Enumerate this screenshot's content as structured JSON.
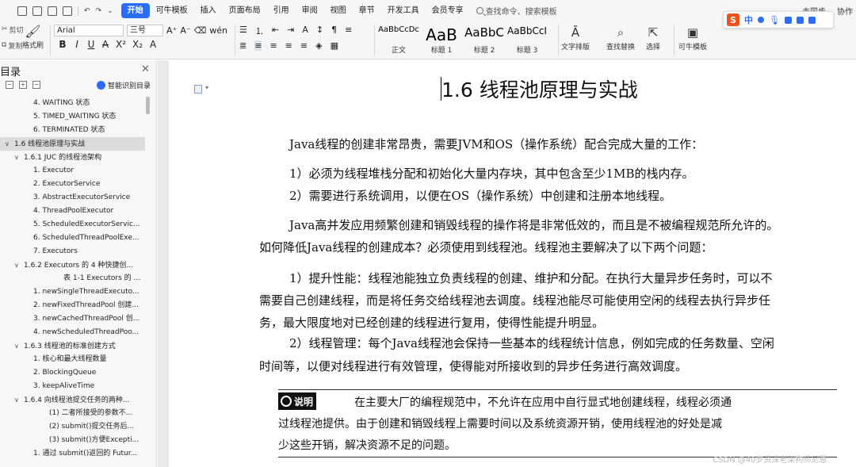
{
  "menubar": {
    "tabs": [
      "开始",
      "可牛模板",
      "插入",
      "页面布局",
      "引用",
      "审阅",
      "视图",
      "章节",
      "开发工具",
      "会员专享"
    ],
    "active_tab": "开始",
    "search_placeholder": "查找命令、搜索模板",
    "right_items": [
      "未同步",
      "协作"
    ]
  },
  "ribbon": {
    "clipboard": {
      "cut": "剪切",
      "copy": "复制",
      "format_painter": "格式刷"
    },
    "font": {
      "name": "Arial",
      "size": "三号"
    },
    "format_buttons": [
      "B",
      "I",
      "U",
      "A",
      "X²",
      "X₂",
      "A"
    ],
    "styles": [
      {
        "preview": "AaBbCcDc",
        "label": "正文",
        "size": 10
      },
      {
        "preview": "AaB",
        "label": "标题 1",
        "size": 20
      },
      {
        "preview": "AaBbC",
        "label": "标题 2",
        "size": 15
      },
      {
        "preview": "AaBbCcI",
        "label": "标题 3",
        "size": 12
      }
    ],
    "text_layout": "文字排版",
    "find_replace": "查找替换",
    "select": "选择",
    "template": "可牛模板"
  },
  "ime": {
    "logo": "S",
    "lang": "中"
  },
  "sidebar": {
    "title": "目录",
    "smart_toc": "智能识别目录",
    "items": [
      {
        "text": "4. WAITING 状态",
        "indent": 42,
        "caret": "",
        "selected": false
      },
      {
        "text": "5. TIMED_WAITING 状态",
        "indent": 42,
        "caret": "",
        "selected": false
      },
      {
        "text": "6. TERMINATED 状态",
        "indent": 42,
        "caret": "",
        "selected": false
      },
      {
        "text": "1.6 线程池原理与实战",
        "indent": 6,
        "caret": "∨",
        "selected": true
      },
      {
        "text": "1.6.1 JUC 的线程池架构",
        "indent": 18,
        "caret": "∨",
        "selected": false
      },
      {
        "text": "1. Executor",
        "indent": 42,
        "caret": "",
        "selected": false
      },
      {
        "text": "2. ExecutorService",
        "indent": 42,
        "caret": "",
        "selected": false
      },
      {
        "text": "3. AbstractExecutorService",
        "indent": 42,
        "caret": "",
        "selected": false
      },
      {
        "text": "4. ThreadPoolExecutor",
        "indent": 42,
        "caret": "",
        "selected": false
      },
      {
        "text": "5. ScheduledExecutorServic...",
        "indent": 42,
        "caret": "",
        "selected": false
      },
      {
        "text": "6. ScheduledThreadPoolExe...",
        "indent": 42,
        "caret": "",
        "selected": false
      },
      {
        "text": "7. Executors",
        "indent": 42,
        "caret": "",
        "selected": false
      },
      {
        "text": "1.6.2 Executors 的 4 种快捷创...",
        "indent": 18,
        "caret": "∨",
        "selected": false
      },
      {
        "text": "表 1-1 Executors 的 4 ...",
        "indent": 80,
        "caret": "",
        "selected": false
      },
      {
        "text": "1. newSingleThreadExecuto...",
        "indent": 42,
        "caret": "",
        "selected": false
      },
      {
        "text": "2. newFixedThreadPool 创建...",
        "indent": 42,
        "caret": "",
        "selected": false
      },
      {
        "text": "3. newCachedThreadPool 创...",
        "indent": 42,
        "caret": "",
        "selected": false
      },
      {
        "text": "4. newScheduledThreadPoo...",
        "indent": 42,
        "caret": "",
        "selected": false
      },
      {
        "text": "1.6.3 线程池的标准创建方式",
        "indent": 18,
        "caret": "∨",
        "selected": false
      },
      {
        "text": "1. 核心和最大线程数量",
        "indent": 42,
        "caret": "",
        "selected": false
      },
      {
        "text": "2. BlockingQueue",
        "indent": 42,
        "caret": "",
        "selected": false
      },
      {
        "text": "3. keepAliveTime",
        "indent": 42,
        "caret": "",
        "selected": false
      },
      {
        "text": "1.6.4 向线程池提交任务的两种...",
        "indent": 18,
        "caret": "∨",
        "selected": false
      },
      {
        "text": "(1) 二者所接受的参数不...",
        "indent": 62,
        "caret": "",
        "selected": false
      },
      {
        "text": "(2) submit()提交任务后...",
        "indent": 62,
        "caret": "",
        "selected": false
      },
      {
        "text": "(3) submit()方便Excepti...",
        "indent": 62,
        "caret": "",
        "selected": false
      },
      {
        "text": "1. 通过 submit()返回的 Futur...",
        "indent": 42,
        "caret": "",
        "selected": false
      }
    ]
  },
  "document": {
    "heading": "1.6   线程池原理与实战",
    "paragraphs": [
      "Java线程的创建非常昂贵，需要JVM和OS（操作系统）配合完成大量的工作：",
      "1）必须为线程堆栈分配和初始化大量内存块，其中包含至少1MB的栈内存。",
      "2）需要进行系统调用，以便在OS（操作系统）中创建和注册本地线程。",
      "Java高并发应用频繁创建和销毁线程的操作将是非常低效的，而且是不被编程规范所允许的。",
      "如何降低Java线程的创建成本？必须使用到线程池。线程池主要解决了以下两个问题：",
      "1）提升性能：线程池能独立负责线程的创建、维护和分配。在执行大量异步任务时，可以不",
      "需要自己创建线程，而是将任务交给线程池去调度。线程池能尽可能使用空闲的线程去执行异步任",
      "务，最大限度地对已经创建的线程进行复用，使得性能提升明显。",
      "2）线程管理：每个Java线程池会保持一些基本的线程统计信息，例如完成的任务数量、空闲",
      "时间等，以便对线程进行有效管理，使得能对所接收到的异步任务进行高效调度。"
    ],
    "note": {
      "badge": "说明",
      "lines": [
        "在主要大厂的编程规范中，不允许在应用中自行显式地创建线程，线程必须通",
        "过线程池提供。由于创建和销毁线程上需要时间以及系统资源开销，使用线程池的好处是减",
        "少这些开销，解决资源不足的问题。"
      ]
    },
    "watermark": "CSDN @40岁资深老架构师尼恩"
  }
}
